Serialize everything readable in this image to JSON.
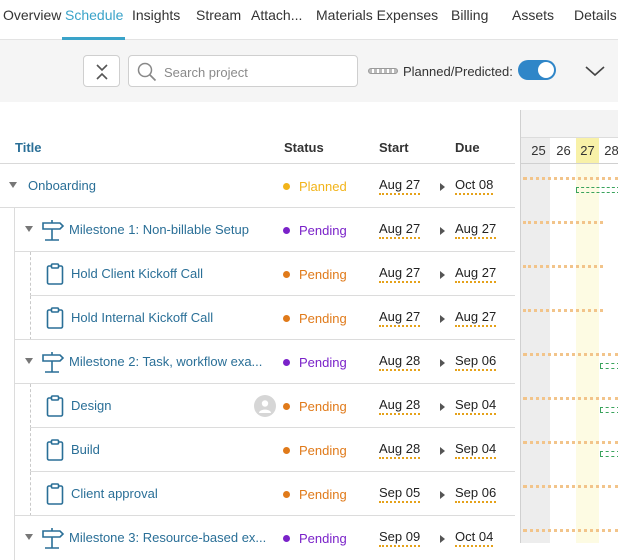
{
  "tabs": [
    {
      "label": "Overview"
    },
    {
      "label": "Schedule"
    },
    {
      "label": "Insights"
    },
    {
      "label": "Stream"
    },
    {
      "label": "Attach..."
    },
    {
      "label": "Materials Expenses"
    },
    {
      "label": "Billing"
    },
    {
      "label": "Assets"
    },
    {
      "label": "Details"
    }
  ],
  "active_tab": "Schedule",
  "toolbar": {
    "search_placeholder": "Search project",
    "toggle_label": "Planned/Predicted:",
    "toggle_on": true
  },
  "columns": {
    "title": "Title",
    "status": "Status",
    "start": "Start",
    "due": "Due"
  },
  "colors": {
    "accent": "#3aa3c9",
    "link": "#2a6f97",
    "planned": "#f2b41a",
    "pending_milestone": "#7a22c9",
    "pending_task": "#e07a1a",
    "toggle": "#2f86c8"
  },
  "rows": [
    {
      "name": "Onboarding",
      "type": "project",
      "status": "Planned",
      "start": "Aug 27",
      "due": "Oct 08"
    },
    {
      "name": "Milestone 1: Non-billable Setup",
      "type": "milestone",
      "status": "Pending",
      "start": "Aug 27",
      "due": "Aug 27"
    },
    {
      "name": "Hold Client Kickoff Call",
      "type": "task",
      "status": "Pending",
      "start": "Aug 27",
      "due": "Aug 27"
    },
    {
      "name": "Hold Internal Kickoff Call",
      "type": "task",
      "status": "Pending",
      "start": "Aug 27",
      "due": "Aug 27"
    },
    {
      "name": "Milestone 2: Task, workflow exa...",
      "type": "milestone",
      "status": "Pending",
      "start": "Aug 28",
      "due": "Sep 06"
    },
    {
      "name": "Design",
      "type": "task",
      "status": "Pending",
      "start": "Aug 28",
      "due": "Sep 04",
      "avatar": true
    },
    {
      "name": "Build",
      "type": "task",
      "status": "Pending",
      "start": "Aug 28",
      "due": "Sep 04"
    },
    {
      "name": "Client approval",
      "type": "task",
      "status": "Pending",
      "start": "Sep 05",
      "due": "Sep 06"
    },
    {
      "name": "Milestone 3: Resource-based ex...",
      "type": "milestone",
      "status": "Pending",
      "start": "Sep 09",
      "due": "Oct 04"
    }
  ],
  "gantt": {
    "days": [
      "25",
      "26",
      "27",
      "28"
    ],
    "today": "27"
  }
}
